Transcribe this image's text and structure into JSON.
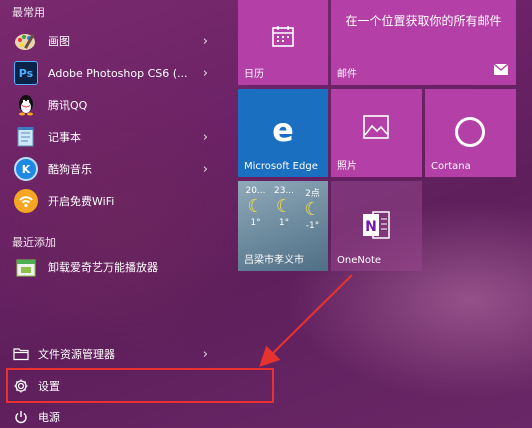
{
  "start_menu": {
    "most_used_label": "最常用",
    "recently_added_label": "最近添加",
    "apps": [
      {
        "label": "画图",
        "icon": "paint-icon",
        "has_arrow": true
      },
      {
        "label": "Adobe Photoshop CS6 (...",
        "icon": "photoshop-icon",
        "icon_text": "Ps",
        "has_arrow": true
      },
      {
        "label": "腾讯QQ",
        "icon": "qq-icon",
        "has_arrow": false
      },
      {
        "label": "记事本",
        "icon": "notepad-icon",
        "has_arrow": true
      },
      {
        "label": "酷狗音乐",
        "icon": "kugou-icon",
        "icon_text": "K",
        "has_arrow": true
      },
      {
        "label": "开启免费WiFi",
        "icon": "wifi-icon",
        "has_arrow": false
      }
    ],
    "recent_apps": [
      {
        "label": "卸载爱奇艺万能播放器",
        "icon": "uninstall-icon"
      }
    ],
    "system": {
      "file_explorer_label": "文件资源管理器",
      "settings_label": "设置",
      "power_label": "电源"
    }
  },
  "tiles": {
    "calendar": {
      "label": "日历",
      "color": "#b43fa6"
    },
    "mail": {
      "label": "邮件",
      "title": "在一个位置获取你的所有邮件",
      "color": "#b43fa6"
    },
    "edge": {
      "label": "Microsoft Edge",
      "color": "#1a6fc0"
    },
    "photos": {
      "label": "照片",
      "color": "#b43fa6"
    },
    "cortana": {
      "label": "Cortana",
      "color": "#b43fa6"
    },
    "weather": {
      "label": "吕梁市孝义市",
      "days": [
        {
          "day": "20...",
          "temp": "1°"
        },
        {
          "day": "23...",
          "temp": "1°"
        },
        {
          "day": "2点",
          "temp": "-1°"
        }
      ]
    },
    "onenote": {
      "label": "OneNote",
      "icon_text": "N"
    }
  },
  "colors": {
    "accent_tile": "#b43fa6",
    "edge_tile": "#1a6fc0",
    "highlight": "#e8322f"
  }
}
